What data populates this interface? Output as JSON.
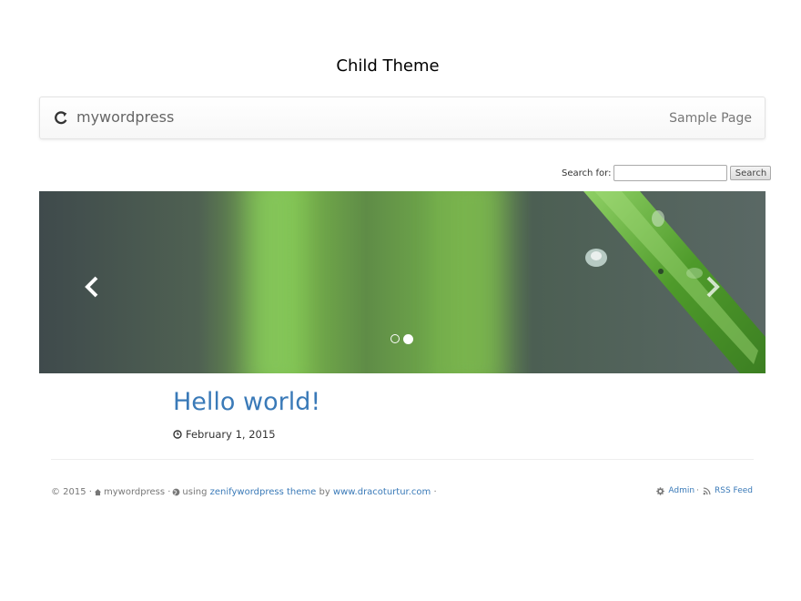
{
  "site": {
    "title": "Child Theme"
  },
  "navbar": {
    "brand": "mywordpress",
    "links": [
      "Sample Page"
    ]
  },
  "search": {
    "label": "Search for:",
    "value": "",
    "button": "Search"
  },
  "carousel": {
    "slide_count": 2,
    "active_index": 1
  },
  "post": {
    "title": "Hello world!",
    "date": "February 1, 2015"
  },
  "footer": {
    "copyright": "© 2015 ·",
    "site_name": "mywordpress ·",
    "using": "using",
    "theme_link": "zenifywordpress theme",
    "by": "by",
    "author_link": "www.dracoturtur.com",
    "trail": "·",
    "admin_link": "Admin",
    "sep": "·",
    "rss_link": "RSS Feed"
  },
  "colors": {
    "link": "#3a7ab8",
    "text": "#333333",
    "muted": "#777777"
  }
}
